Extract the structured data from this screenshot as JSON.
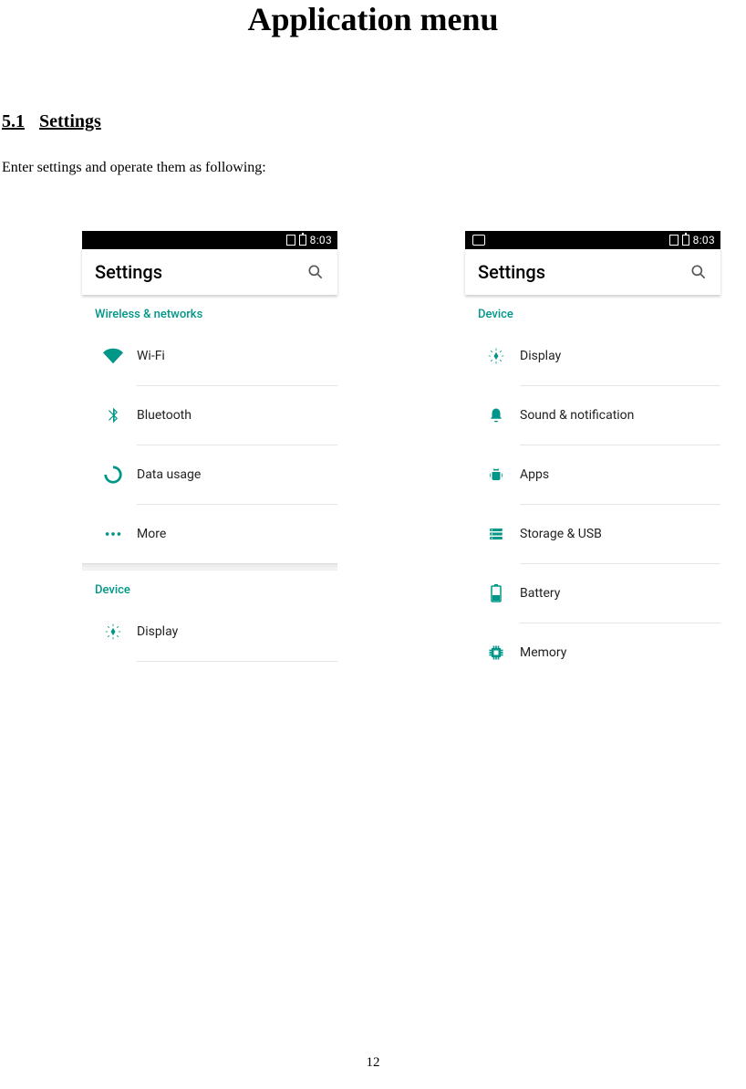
{
  "page": {
    "title": "Application menu",
    "section_number": "5.1",
    "section_title": "Settings",
    "intro": "Enter settings and operate them as following:",
    "page_number": "12"
  },
  "common": {
    "time": "8:03",
    "appbar_title": "Settings"
  },
  "colors": {
    "teal": "#009688"
  },
  "left_screen": {
    "section1": "Wireless & networks",
    "items1": [
      {
        "icon": "wifi-icon",
        "label": "Wi-Fi"
      },
      {
        "icon": "bluetooth-icon",
        "label": "Bluetooth"
      },
      {
        "icon": "data-usage-icon",
        "label": "Data usage"
      },
      {
        "icon": "more-icon",
        "label": "More"
      }
    ],
    "section2": "Device",
    "items2": [
      {
        "icon": "display-icon",
        "label": "Display"
      }
    ]
  },
  "right_screen": {
    "section1": "Device",
    "items1": [
      {
        "icon": "display-icon",
        "label": "Display"
      },
      {
        "icon": "sound-icon",
        "label": "Sound & notification"
      },
      {
        "icon": "apps-icon",
        "label": "Apps"
      },
      {
        "icon": "storage-icon",
        "label": "Storage & USB"
      },
      {
        "icon": "battery-icon",
        "label": "Battery"
      },
      {
        "icon": "memory-icon",
        "label": "Memory"
      }
    ]
  }
}
